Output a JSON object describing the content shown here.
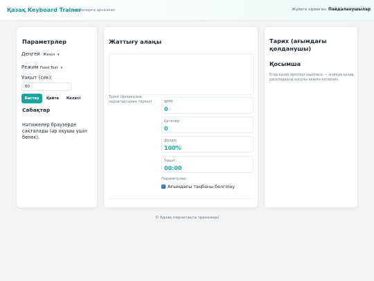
{
  "header": {
    "brand": "Қазақ Keyboard Trainer",
    "tagline": "— оқушыларға арналған",
    "nav": {
      "login": "Жүйеге кірмеген",
      "user": "Пайдаланушылар"
    }
  },
  "settings": {
    "title": "Параметрлер",
    "level_label": "Деңгей",
    "level_value": "Жеңіл",
    "mode_label": "Режим",
    "mode_value": "Fixed Text",
    "time_label": "Уақыт (сек):",
    "time_value": "60",
    "buttons": {
      "start": "Бастау",
      "again": "Қайта",
      "next": "Келесі"
    },
    "lessons_title": "Сабақтар",
    "note": "Нәтижелер браузерде сақталады (әр оқушы үшін бөлек)."
  },
  "training": {
    "title": "Жаттығу алаңы",
    "typed_label": "Typed (физикалық пернетақтамен теріңіз)",
    "stats": [
      {
        "label": "WPM",
        "value": "0"
      },
      {
        "label": "Қателер",
        "value": "0"
      },
      {
        "label": "Дәлдік",
        "value": "100%"
      },
      {
        "label": "Уақыт",
        "value": "00:00"
      }
    ],
    "params_label": "Параметрлер",
    "highlight_label": "Ағымдағы таңбаны белгілеу",
    "highlight_checked": true
  },
  "history": {
    "title": "Тарих (ағымдағы қолданушы)",
    "extra_title": "Қосымша",
    "extra_note": "Егер қазақ әріптері шықпаса — жүйеде қазақ раскладкасы қосулы екенін ексеріңіз."
  },
  "footer": {
    "text": "© Қазақ пернетақта тренажері"
  },
  "colors": {
    "accent": "#1aa6a0",
    "brand": "#1a9a98",
    "checkbox": "#1f6fd1",
    "background": "#f1f3f5"
  }
}
